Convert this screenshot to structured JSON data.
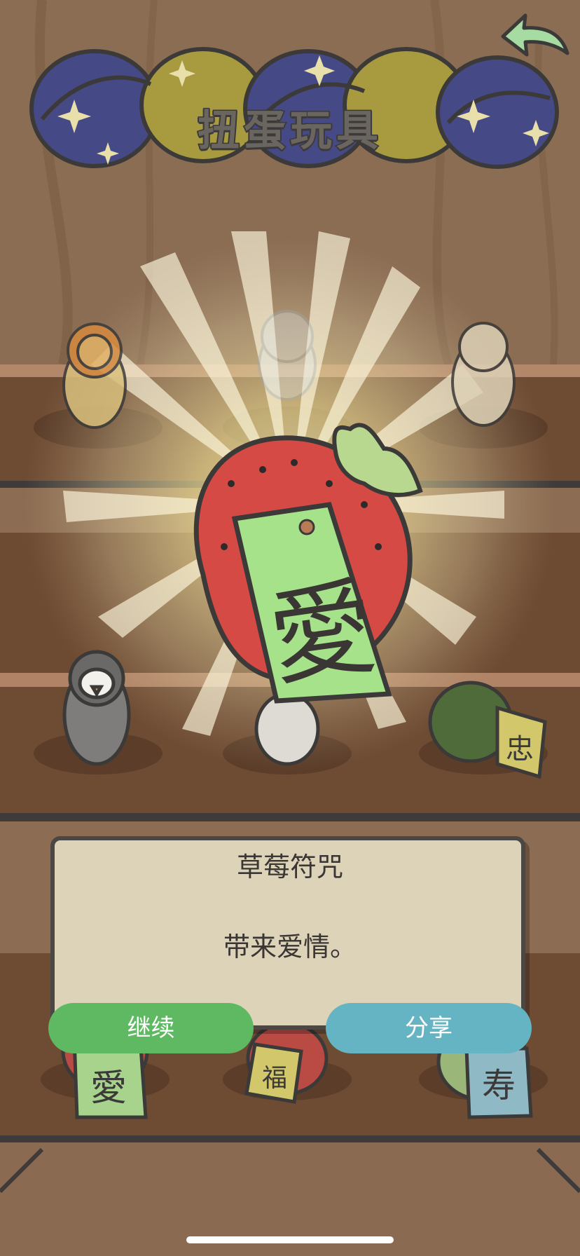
{
  "header": {
    "title": "扭蛋玩具",
    "back_icon": "back-arrow-icon"
  },
  "reveal": {
    "charm_character": "愛"
  },
  "dialog": {
    "title": "草莓符咒",
    "description": "带来爱情。",
    "continue_label": "继续",
    "share_label": "分享"
  },
  "shelf": {
    "item_characters": [
      "忠",
      "愛",
      "福",
      "寿"
    ]
  },
  "colors": {
    "continue_button": "#5fb962",
    "share_button": "#65b4c3",
    "dialog_bg": "#ddd3b8",
    "charm_green": "#a6e28a",
    "strawberry_red": "#d54a44"
  }
}
